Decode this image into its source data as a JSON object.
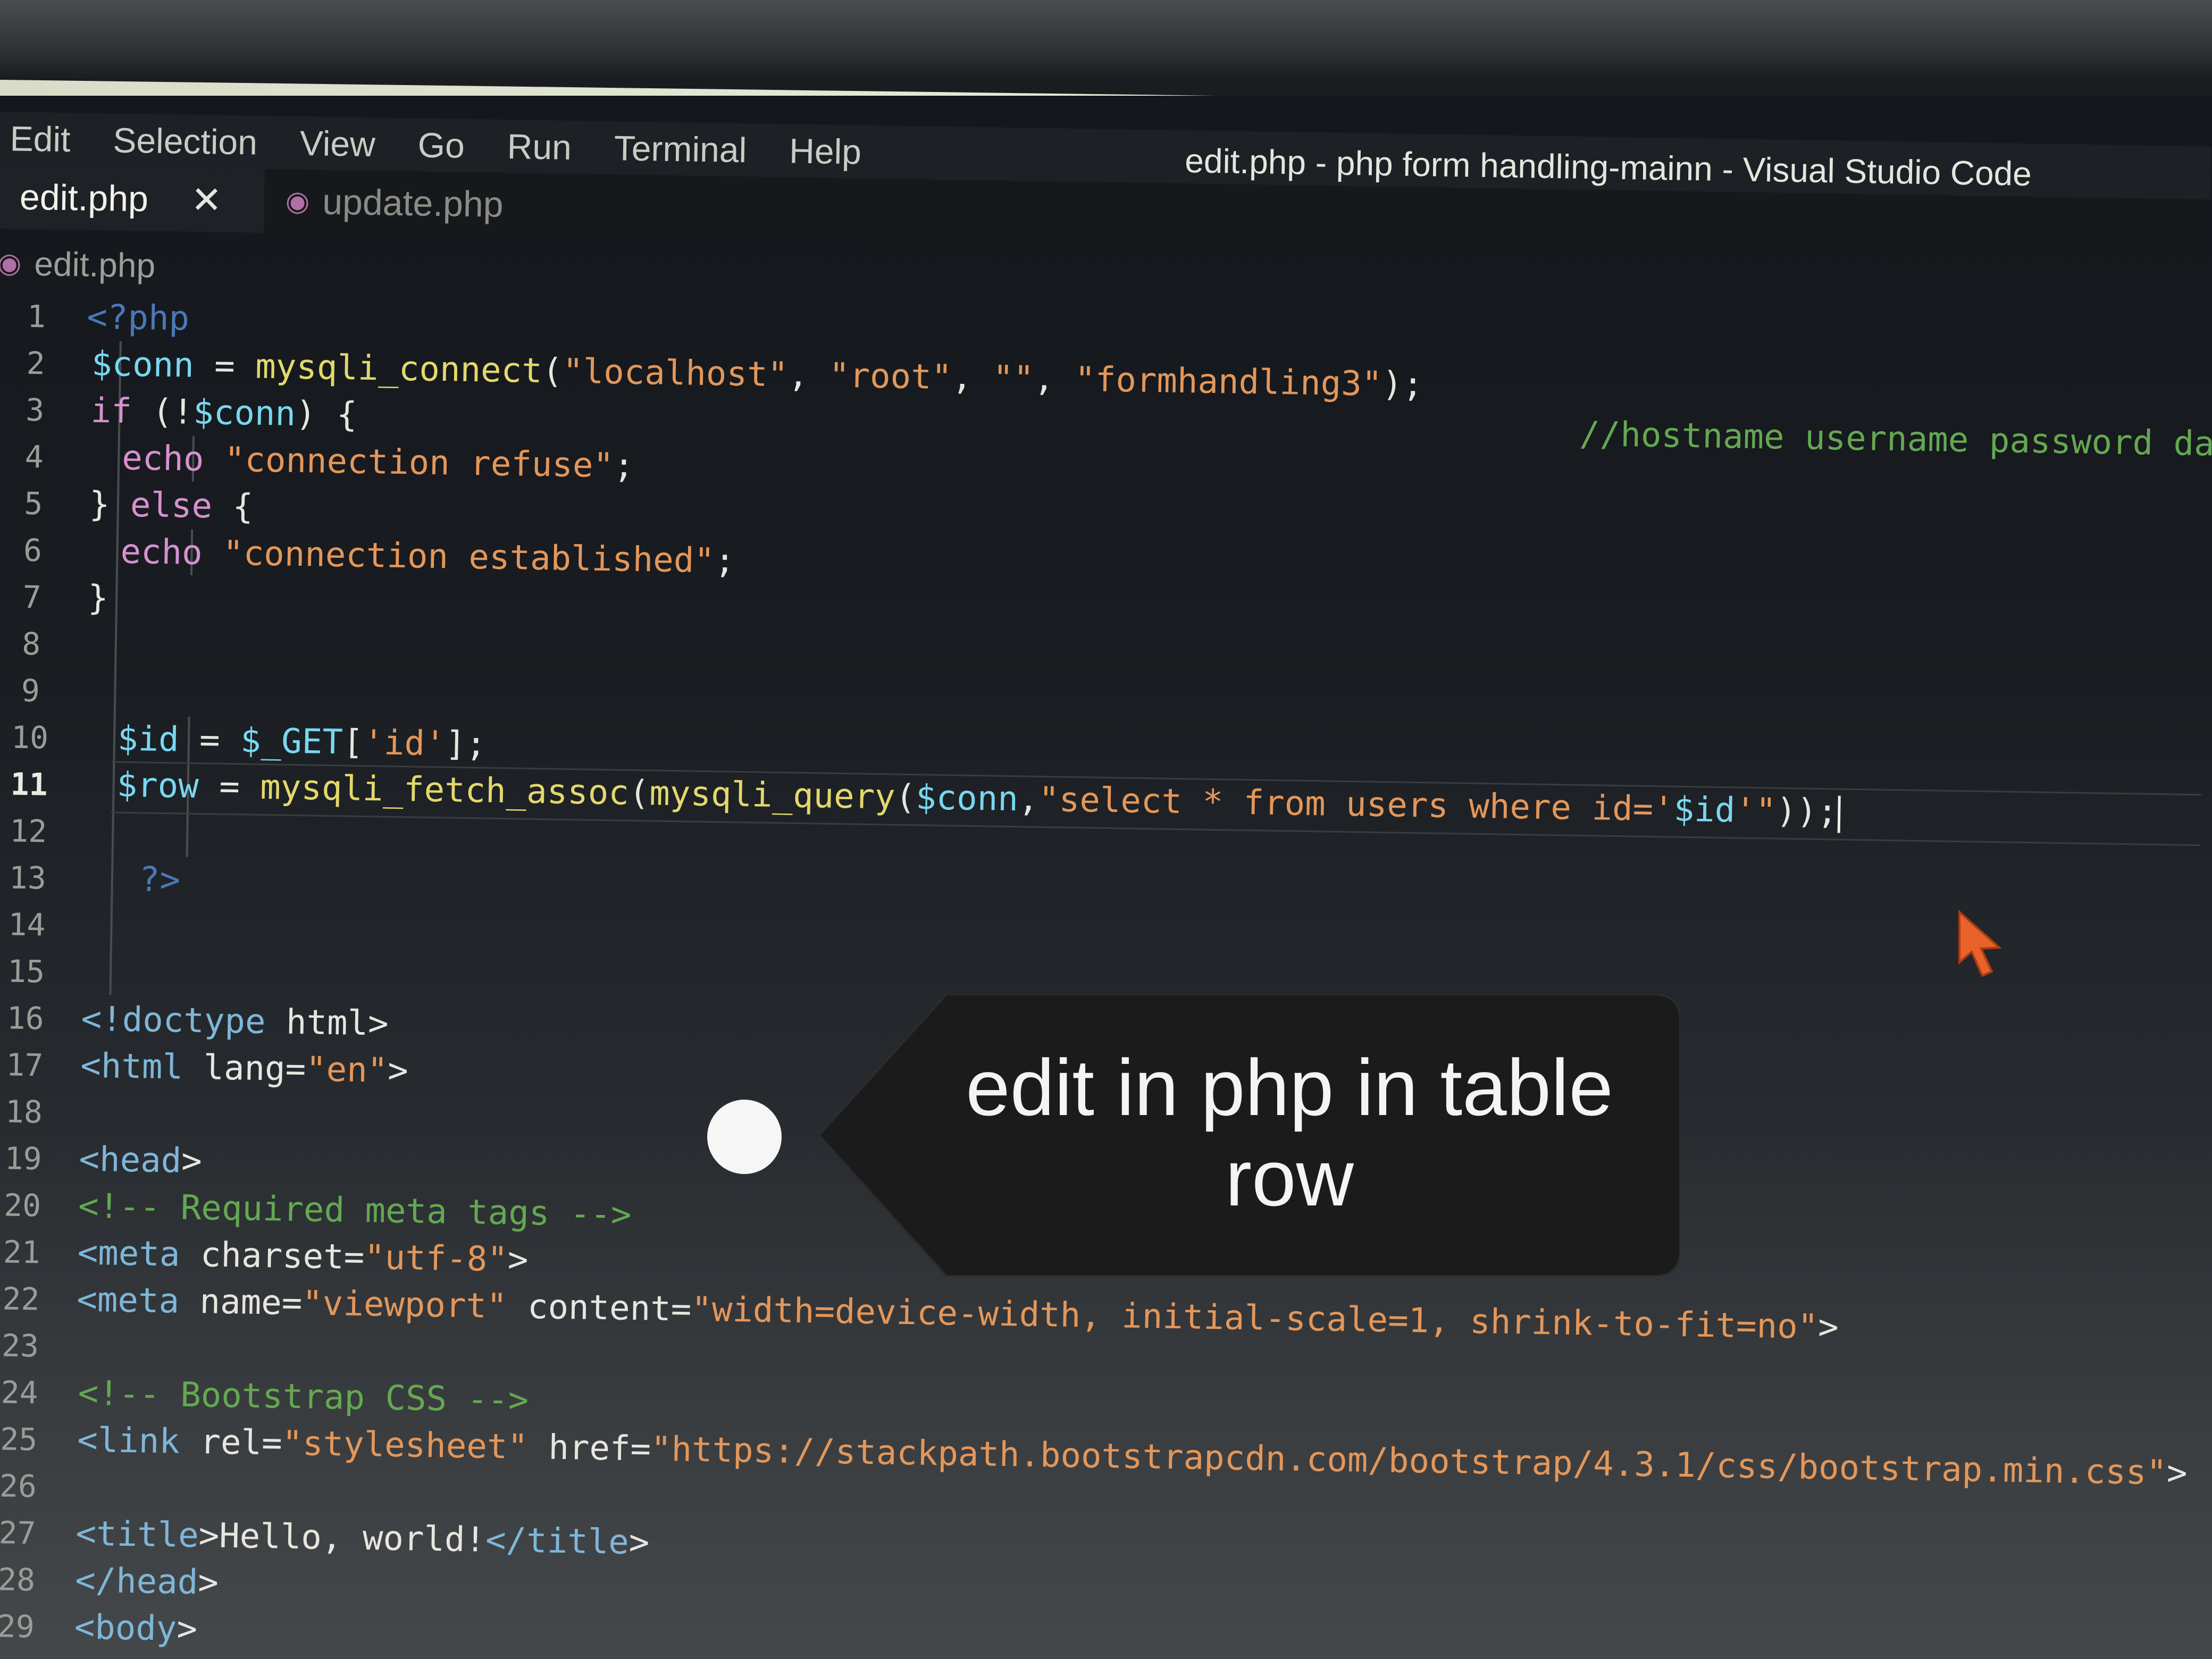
{
  "window": {
    "title": "edit.php - php form handling-mainn - Visual Studio Code"
  },
  "menu": [
    "Edit",
    "Selection",
    "View",
    "Go",
    "Run",
    "Terminal",
    "Help"
  ],
  "tabs": [
    {
      "label": "edit.php",
      "active": true,
      "close": "✕"
    },
    {
      "label": "update.php",
      "active": false
    }
  ],
  "breadcrumb": "edit.php",
  "editor": {
    "current_line": 11,
    "lines": [
      {
        "n": "1",
        "code": "<?php"
      },
      {
        "n": "2",
        "code": "$conn = mysqli_connect(\"localhost\", \"root\", \"\", \"formhandling3\");"
      },
      {
        "n": "3",
        "code": "if (!$conn) {",
        "comment": "//hostname username password data"
      },
      {
        "n": "4",
        "code": "echo \"connection refuse\";"
      },
      {
        "n": "5",
        "code": "} else {"
      },
      {
        "n": "6",
        "code": "echo \"connection established\";"
      },
      {
        "n": "7",
        "code": "}"
      },
      {
        "n": "8",
        "code": ""
      },
      {
        "n": "9",
        "code": ""
      },
      {
        "n": "10",
        "code": "$id = $_GET['id'];"
      },
      {
        "n": "11",
        "code": "$row = mysqli_fetch_assoc(mysqli_query($conn,\"select * from users where id='$id'\"));"
      },
      {
        "n": "12",
        "code": ""
      },
      {
        "n": "13",
        "code": "?>"
      },
      {
        "n": "14",
        "code": ""
      },
      {
        "n": "15",
        "code": ""
      },
      {
        "n": "16",
        "code": "<!doctype html>"
      },
      {
        "n": "17",
        "code": "<html lang=\"en\">"
      },
      {
        "n": "18",
        "code": ""
      },
      {
        "n": "19",
        "code": "<head>"
      },
      {
        "n": "20",
        "code": "<!-- Required meta tags -->"
      },
      {
        "n": "21",
        "code": "<meta charset=\"utf-8\">"
      },
      {
        "n": "22",
        "code": "<meta name=\"viewport\" content=\"width=device-width, initial-scale=1, shrink-to-fit=no\">"
      },
      {
        "n": "23",
        "code": ""
      },
      {
        "n": "24",
        "code": "<!-- Bootstrap CSS -->"
      },
      {
        "n": "25",
        "code": "<link rel=\"stylesheet\" href=\"https://stackpath.bootstrapcdn.com/bootstrap/4.3.1/css/bootstrap.min.css\">"
      },
      {
        "n": "26",
        "code": ""
      },
      {
        "n": "27",
        "code": "<title>Hello, world!</title>"
      },
      {
        "n": "28",
        "code": "</head>"
      },
      {
        "n": "29",
        "code": "<body>"
      }
    ]
  },
  "callout": {
    "text": "edit in php in table row"
  },
  "colors": {
    "variable": "#78d7f0",
    "function": "#e3d86b",
    "string": "#e3975a",
    "keyword": "#d690d0",
    "comment": "#64a851",
    "callout_bg": "#1b1b1b"
  }
}
